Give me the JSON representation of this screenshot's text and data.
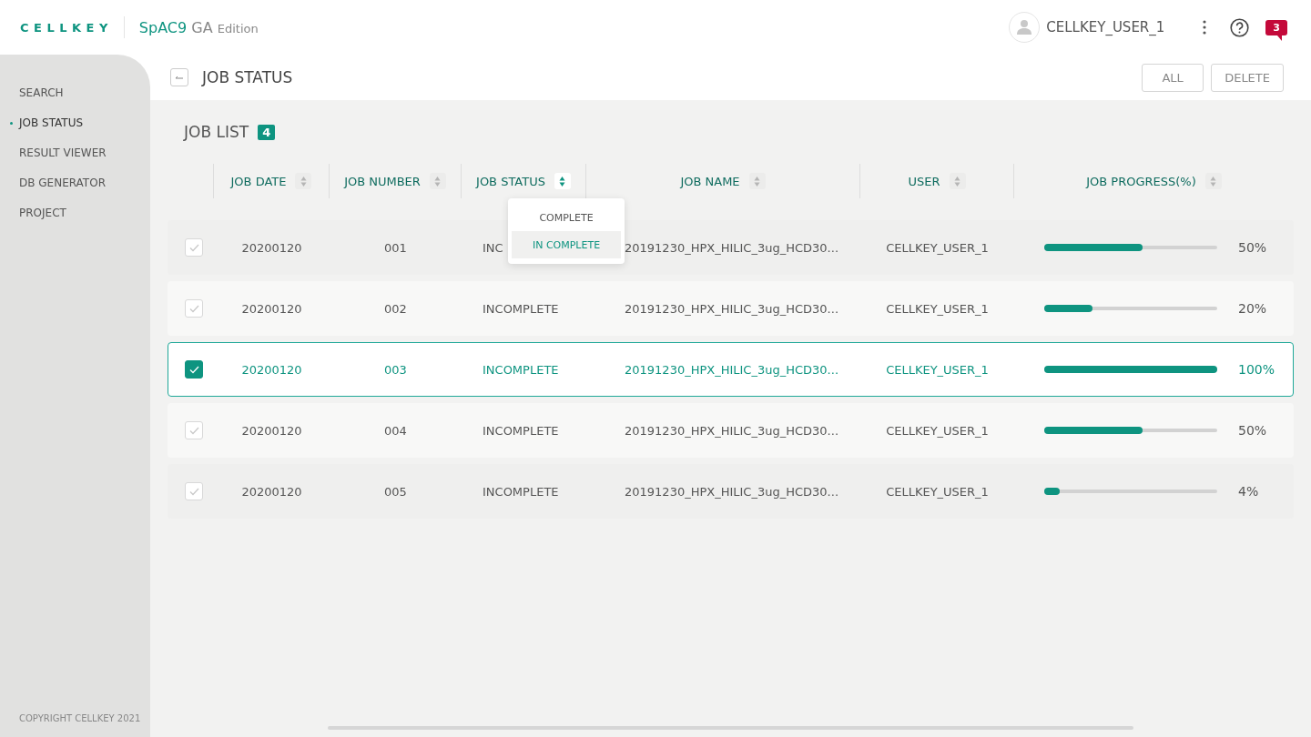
{
  "header": {
    "logo": "CELLKEY",
    "product": "SpAC9",
    "edition_code": "GA",
    "edition": "Edition",
    "user": "CELLKEY_USER_1",
    "notification_count": "3"
  },
  "sidebar": {
    "items": [
      {
        "label": "SEARCH",
        "selected": false
      },
      {
        "label": "JOB STATUS",
        "selected": true
      },
      {
        "label": "RESULT VIEWER",
        "selected": false
      },
      {
        "label": "DB GENERATOR",
        "selected": false
      },
      {
        "label": "PROJECT",
        "selected": false
      }
    ],
    "footer": "COPYRIGHT CELLKEY 2021"
  },
  "page": {
    "title": "JOB STATUS",
    "buttons": [
      "ALL",
      "DELETE"
    ]
  },
  "job_list": {
    "title": "JOB LIST",
    "count": "4"
  },
  "table": {
    "columns": [
      {
        "label": "JOB DATE",
        "sort_active": false
      },
      {
        "label": "JOB NUMBER",
        "sort_active": false
      },
      {
        "label": "JOB STATUS",
        "sort_active": true
      },
      {
        "label": "JOB NAME",
        "sort_active": false
      },
      {
        "label": "USER",
        "sort_active": false
      },
      {
        "label": "JOB PROGRESS(%)",
        "sort_active": false
      }
    ],
    "rows": [
      {
        "checked": false,
        "selected": false,
        "date": "20200120",
        "number": "001",
        "status": "INC",
        "name": "20191230_HPX_HILIC_3ug_HCD30...",
        "user": "CELLKEY_USER_1",
        "level": 0.57,
        "progress": "50%"
      },
      {
        "checked": false,
        "selected": false,
        "date": "20200120",
        "number": "002",
        "status": "INCOMPLETE",
        "name": "20191230_HPX_HILIC_3ug_HCD30...",
        "user": "CELLKEY_USER_1",
        "level": 0.28,
        "progress": "20%"
      },
      {
        "checked": true,
        "selected": true,
        "date": "20200120",
        "number": "003",
        "status": "INCOMPLETE",
        "name": "20191230_HPX_HILIC_3ug_HCD30...",
        "user": "CELLKEY_USER_1",
        "level": 1,
        "progress": "100%"
      },
      {
        "checked": false,
        "selected": false,
        "date": "20200120",
        "number": "004",
        "status": "INCOMPLETE",
        "name": "20191230_HPX_HILIC_3ug_HCD30...",
        "user": "CELLKEY_USER_1",
        "level": 0.57,
        "progress": "50%"
      },
      {
        "checked": false,
        "selected": false,
        "date": "20200120",
        "number": "005",
        "status": "INCOMPLETE",
        "name": "20191230_HPX_HILIC_3ug_HCD30...",
        "user": "CELLKEY_USER_1",
        "level": 0.09,
        "progress": "4%"
      }
    ]
  },
  "status_filter_menu": {
    "items": [
      {
        "label": "COMPLETE",
        "selected": false
      },
      {
        "label": "IN COMPLETE",
        "selected": true
      }
    ]
  }
}
